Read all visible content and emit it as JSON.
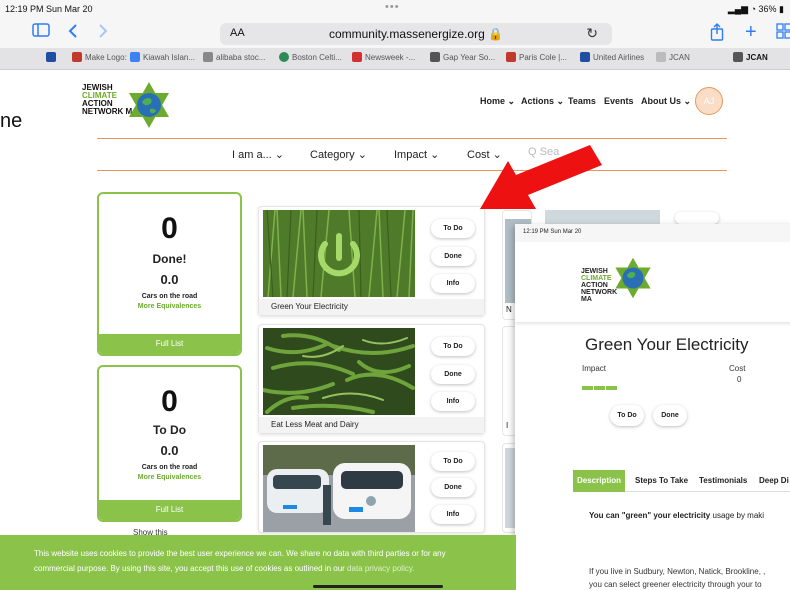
{
  "status_bar": {
    "time": "12:19 PM  Sun Mar 20",
    "dots": "•••",
    "battery": "36%"
  },
  "toolbar": {
    "reader_label": "AA",
    "url": "community.massenergize.org 🔒",
    "reload_icon": "reload-icon",
    "sidebar_icon": "sidebar-icon",
    "back_icon": "back-icon",
    "forward_icon": "forward-icon",
    "share_icon": "share-icon",
    "new_tab_icon": "plus-icon",
    "tabs_icon": "tabs-overview-icon"
  },
  "tabs": [
    {
      "label": "Make Logo:",
      "color": "#c0392b"
    },
    {
      "label": "Kiawah Islan...",
      "color": "#3b82f6"
    },
    {
      "label": "alibaba stoc...",
      "color": "#888888"
    },
    {
      "label": "Boston Celti...",
      "color": "#2e8b57"
    },
    {
      "label": "Newsweek -...",
      "color": "#d32f2f"
    },
    {
      "label": "Gap Year So...",
      "color": "#555555"
    },
    {
      "label": "Paris Cole |...",
      "color": "#c0392b"
    },
    {
      "label": "United Airlines",
      "color": "#1f4fa3"
    },
    {
      "label": "JCAN",
      "color": "#bbbbbb"
    },
    {
      "label": "JCAN",
      "color": "#555555"
    }
  ],
  "stray_text": "ne",
  "logo": {
    "line1": "JEWISH",
    "line2": "CLIMATE",
    "line3": "ACTION",
    "line4": "NETWORK MA"
  },
  "nav": {
    "home": "Home ⌄",
    "actions": "Actions ⌄",
    "teams": "Teams",
    "events": "Events",
    "about": "About Us ⌄",
    "avatar": "AJ"
  },
  "filters": {
    "i_am": "I am a... ⌄",
    "category": "Category ⌄",
    "impact": "Impact ⌄",
    "cost": "Cost ⌄",
    "search_placeholder": "Q  Sea"
  },
  "done_card": {
    "count": "0",
    "label": "Done!",
    "value": "0.0",
    "unit": "Cars on the road",
    "more": "More Equivalences",
    "button": "Full List"
  },
  "todo_card": {
    "count": "0",
    "label": "To Do",
    "value": "0.0",
    "unit": "Cars on the road",
    "more": "More Equivalences",
    "button": "Full List",
    "footer": "Show this"
  },
  "actions": [
    {
      "title": "Green Your Electricity",
      "todo": "To Do",
      "done": "Done",
      "info": "Info",
      "image_icon": "power-icon"
    },
    {
      "title": "Eat Less Meat and Dairy",
      "todo": "To Do",
      "done": "Done",
      "info": "Info",
      "image_icon": "green-beans-photo"
    },
    {
      "title": "",
      "todo": "To Do",
      "done": "Done",
      "info": "Info",
      "image_icon": "electric-cars-photo"
    }
  ],
  "partial_cards": [
    "N",
    "I"
  ],
  "overlay": {
    "status": "12:19 PM  Sun Mar 20",
    "logo": {
      "line1": "JEWISH",
      "line2": "CLIMATE",
      "line3": "ACTION",
      "line4": "NETWORK MA"
    },
    "title": "Green Your Electricity",
    "impact_label": "Impact",
    "cost_label": "Cost",
    "cost_value": "0",
    "impact_level": 3,
    "todo": "To Do",
    "done": "Done",
    "tabs": [
      "Description",
      "Steps To Take",
      "Testimonials",
      "Deep Di"
    ],
    "desc_bold": "You can \"green\" your electricity",
    "desc_rest": " usage by maki",
    "para1": "If you live in Sudbury, Newton, Natick, Brookline, ,",
    "para2": "you can select greener electricity through your to"
  },
  "cookie": {
    "line1": "This website uses cookies to provide the best user experience we can. We share no data with third parties or for any",
    "line2a": "commercial purpose. By using this site, you accept this use of cookies as outlined in our ",
    "link": "data privacy policy."
  },
  "colors": {
    "brand_green": "#8bc34a",
    "accent_orange": "#e8955a",
    "arrow_red": "#ee1111",
    "safari_blue": "#2f7df6"
  }
}
